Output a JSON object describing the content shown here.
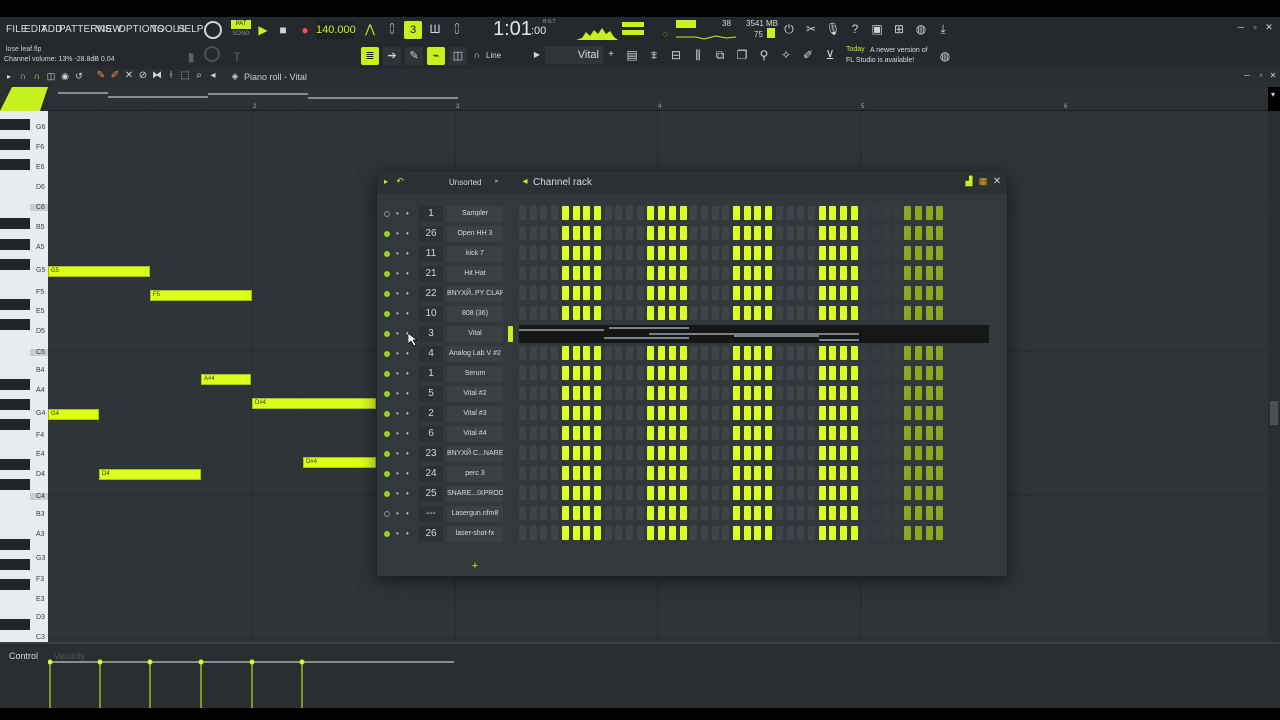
{
  "menu": [
    "FILE",
    "EDIT",
    "ADD",
    "PATTERNS",
    "VIEW",
    "OPTIONS",
    "TOOLS",
    "HELP"
  ],
  "transport": {
    "pat_label": "PAT",
    "song_label": "SONG",
    "tempo": "140.000",
    "time": "1:01",
    "time_sub": ":00",
    "time_unit": "B:S:T"
  },
  "monitor": {
    "cpu": "38",
    "memory": "3541 MB",
    "voices": "75"
  },
  "hint": {
    "file": "lose leaf.flp",
    "status": "Channel volume: 13%  -28.8dB  0.04"
  },
  "toolbar": {
    "snap_label": "Line",
    "preset_label": "Vital"
  },
  "news": {
    "label": "Today",
    "message": "A newer version of FL Studio is available!"
  },
  "piano_roll": {
    "title": "Piano roll - Vital",
    "bars": [
      "2",
      "3",
      "4",
      "5",
      "6"
    ],
    "keys": [
      "G6",
      "F6",
      "E6",
      "D6",
      "C6",
      "B5",
      "A5",
      "G5",
      "F5",
      "E5",
      "D5",
      "C5",
      "B4",
      "A4",
      "G4",
      "F4",
      "E4",
      "D4",
      "C4",
      "B3",
      "A3",
      "G3",
      "F3",
      "E3",
      "D3",
      "C3"
    ],
    "notes": [
      "G5",
      "F5",
      "A#4",
      "G4",
      "D#4",
      "D#4",
      "D4"
    ],
    "control_label": "Control",
    "control_target": "Velocity"
  },
  "channel_rack": {
    "title": "Channel rack",
    "filter": "Unsorted",
    "channels": [
      {
        "num": "1",
        "name": "Sampler",
        "active": false,
        "steps": "0000111100001111000011110000111100001111"
      },
      {
        "num": "26",
        "name": "Open HH 3",
        "active": true,
        "steps": "0000111100001111000011110000111100001111"
      },
      {
        "num": "11",
        "name": "kick 7",
        "active": true,
        "steps": "0000111100001111000011110000111100001111"
      },
      {
        "num": "21",
        "name": "Hit Hat",
        "active": true,
        "steps": "0000111100001111000011110000111100001111"
      },
      {
        "num": "22",
        "name": "BNYXЙ..PY CLAP",
        "active": true,
        "steps": "0000111100001111000011110000111100001111"
      },
      {
        "num": "10",
        "name": "808 (36)",
        "active": true,
        "steps": "0000111100001111000011110000111100001111"
      },
      {
        "num": "3",
        "name": "Vital",
        "active": true,
        "steps": ""
      },
      {
        "num": "4",
        "name": "Analog Lab V #2",
        "active": true,
        "steps": "0000111100001111000011110000111100001111"
      },
      {
        "num": "1",
        "name": "Serum",
        "active": true,
        "steps": "0000111100001111000011110000111100001111"
      },
      {
        "num": "5",
        "name": "Vital #2",
        "active": true,
        "steps": "0000111100001111000011110000111100001111"
      },
      {
        "num": "2",
        "name": "Vital #3",
        "active": true,
        "steps": "0000111100001111000011110000111100001111"
      },
      {
        "num": "6",
        "name": "Vital #4",
        "active": true,
        "steps": "0000111100001111000011110000111100001111"
      },
      {
        "num": "23",
        "name": "BNYXЙ C...NARE",
        "active": true,
        "steps": "0000111100001111000011110000111100001111"
      },
      {
        "num": "24",
        "name": "perc 3",
        "active": true,
        "steps": "0000111100001111000011110000111100001111"
      },
      {
        "num": "25",
        "name": "SNARE...IXPROD",
        "active": true,
        "steps": "0000111100001111000011110000111100001111"
      },
      {
        "num": "---",
        "name": "Lasergun.nfm8",
        "active": false,
        "steps": "0000111100001111000011110000111100001111"
      },
      {
        "num": "26",
        "name": "laser-shot-fx",
        "active": true,
        "steps": "0000111100001111000011110000111100001111"
      }
    ]
  },
  "colors": {
    "accent": "#c6f01e",
    "note": "#ddff1e",
    "panel": "#33383b"
  }
}
